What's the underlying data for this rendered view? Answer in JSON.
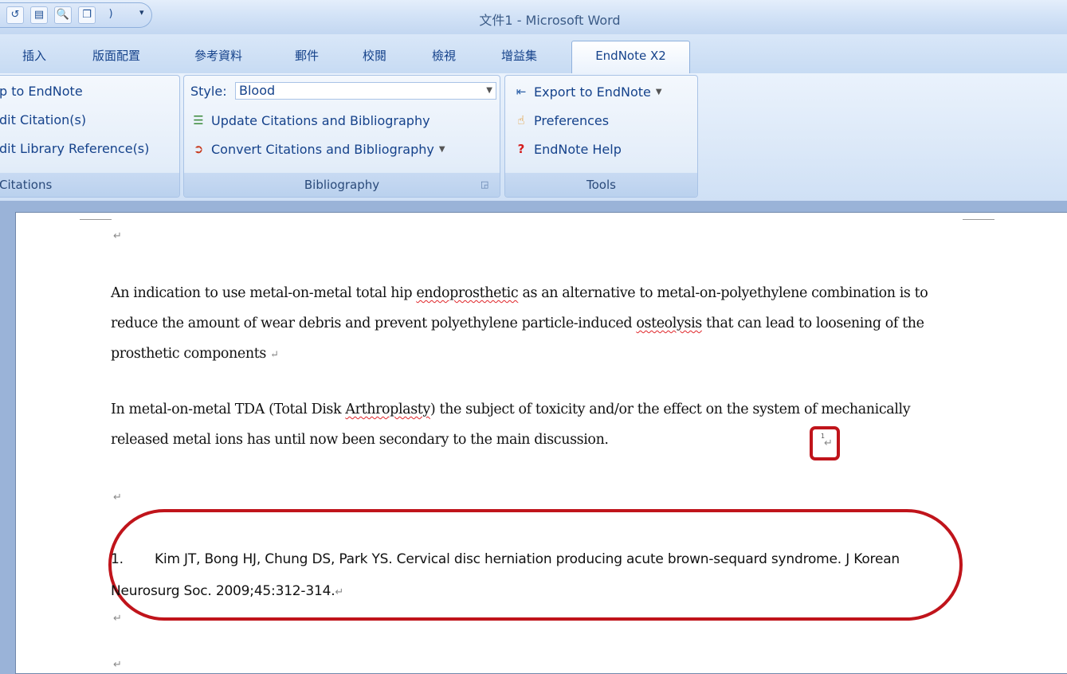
{
  "window": {
    "title": "文件1 - Microsoft Word"
  },
  "quick_access": {
    "icons": [
      "undo-icon",
      "redo-icon",
      "print-preview-icon",
      "new-window-icon"
    ],
    "customize_label": "▾"
  },
  "tabs": [
    {
      "label": "插入"
    },
    {
      "label": "版面配置"
    },
    {
      "label": "參考資料"
    },
    {
      "label": "郵件"
    },
    {
      "label": "校閱"
    },
    {
      "label": "檢視"
    },
    {
      "label": "增益集"
    },
    {
      "label": "EndNote X2",
      "active": true
    }
  ],
  "ribbon": {
    "citations": {
      "label": "Citations",
      "items": [
        "Go to EndNote",
        "Edit Citation(s)",
        "Edit Library Reference(s)"
      ],
      "visible_label": "Citations",
      "visible_items": [
        "p to EndNote",
        "dit Citation(s)",
        "dit Library Reference(s)"
      ],
      "visible_group": "Citations"
    },
    "bibliography": {
      "style_label": "Style:",
      "style_value": "Blood",
      "update": "Update Citations and Bibliography",
      "convert": "Convert Citations and Bibliography",
      "label": "Bibliography"
    },
    "tools": {
      "export": "Export to EndNote",
      "preferences": "Preferences",
      "help": "EndNote Help",
      "label": "Tools"
    }
  },
  "document": {
    "para1": {
      "a": "An indication to use metal-on-metal total hip ",
      "b": "endoprosthetic",
      "c": " as an alternative to metal-on-polyethylene combination is to reduce the amount of wear debris and prevent polyethylene particle-induced ",
      "d": "osteolysis",
      "e": " that can lead to loosening of the prosthetic components "
    },
    "para2": {
      "a": "In metal-on-metal TDA (Total Disk ",
      "b": "Arthroplasty",
      "c": ") the subject of toxicity and/or the effect on the system of mechanically released metal ions has until now been secondary to the main discussion. "
    },
    "citation_number": "1",
    "reference": {
      "number": "1.",
      "text": "Kim JT, Bong HJ, Chung DS, Park YS. Cervical disc herniation producing acute brown-sequard syndrome. J Korean Neurosurg Soc. 2009;45:312-314."
    },
    "para_mark": "↵",
    "highlight_color": "#c0141b"
  }
}
